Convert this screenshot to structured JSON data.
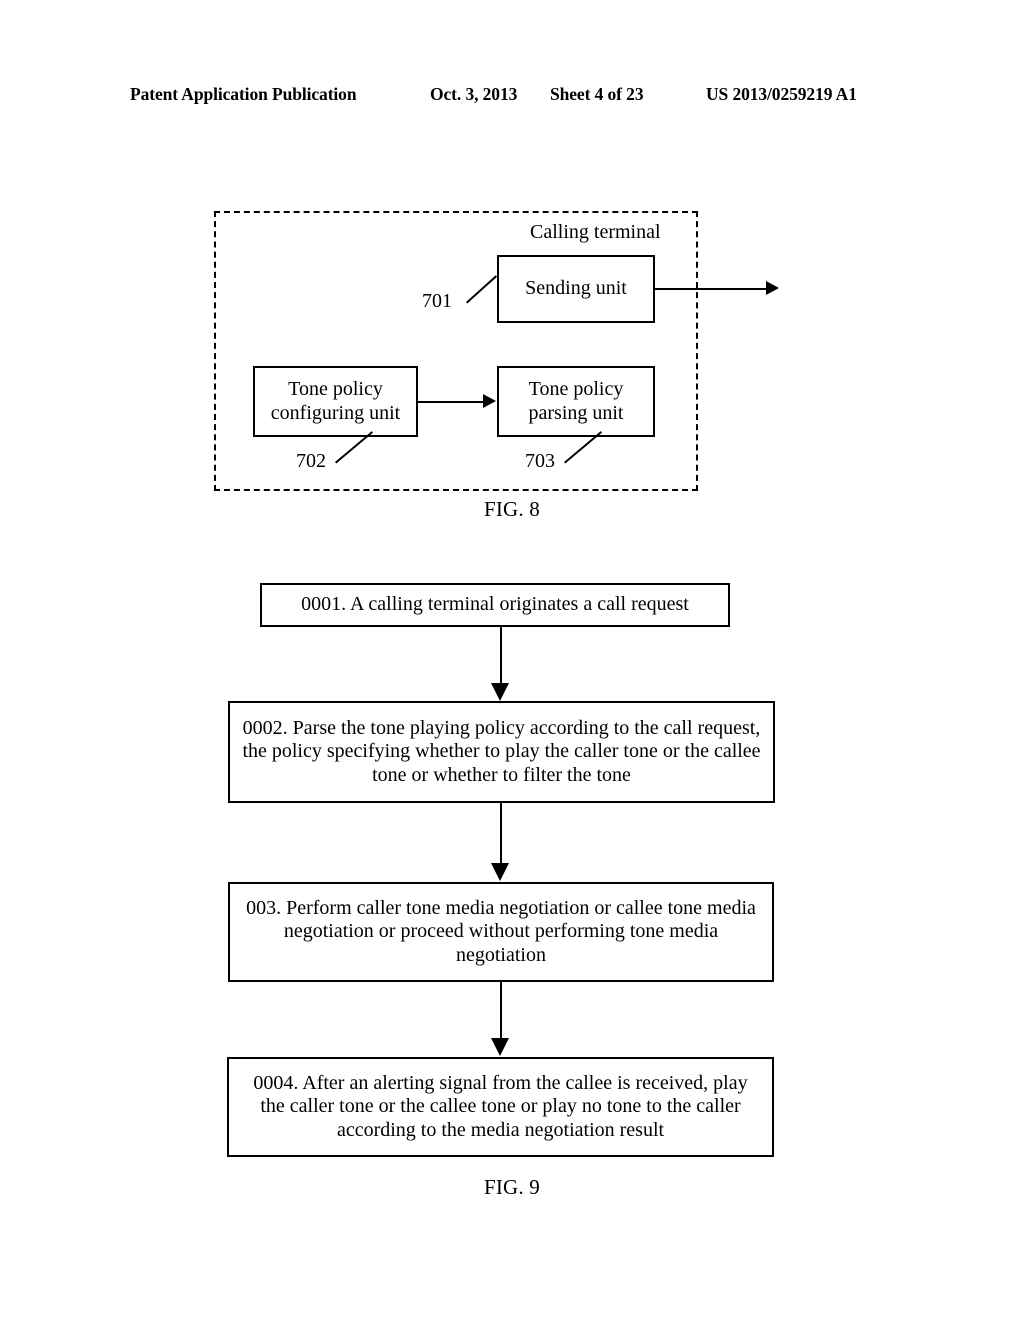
{
  "header": {
    "publication": "Patent Application Publication",
    "date": "Oct. 3, 2013",
    "sheet": "Sheet 4 of 23",
    "patent_number": "US 2013/0259219 A1"
  },
  "figure8": {
    "caption": "FIG. 8",
    "container_label": "Calling terminal",
    "units": [
      {
        "ref": "701",
        "label": "Sending unit"
      },
      {
        "ref": "702",
        "label": "Tone policy\nconfiguring unit"
      },
      {
        "ref": "703",
        "label": "Tone policy\nparsing unit"
      }
    ],
    "unit_701_label": "Sending unit",
    "unit_701_ref": "701",
    "unit_702_line1": "Tone policy",
    "unit_702_line2": "configuring unit",
    "unit_702_ref": "702",
    "unit_703_line1": "Tone policy",
    "unit_703_line2": "parsing unit",
    "unit_703_ref": "703"
  },
  "figure9": {
    "caption": "FIG. 9",
    "steps": [
      {
        "id": "0001",
        "text": "0001. A calling terminal originates a call request"
      },
      {
        "id": "0002",
        "text": "0002. Parse the tone playing policy according to the call request, the policy specifying whether to play the caller tone or the callee tone or whether to filter the tone"
      },
      {
        "id": "003",
        "text": "003. Perform caller tone media negotiation or callee tone media negotiation or proceed without performing tone media negotiation"
      },
      {
        "id": "0004",
        "text": "0004. After an alerting signal from the callee is received, play the caller tone or the callee tone or play no tone to the caller according to the media negotiation result"
      }
    ]
  },
  "colors": {
    "ink": "#000000",
    "paper": "#ffffff"
  }
}
